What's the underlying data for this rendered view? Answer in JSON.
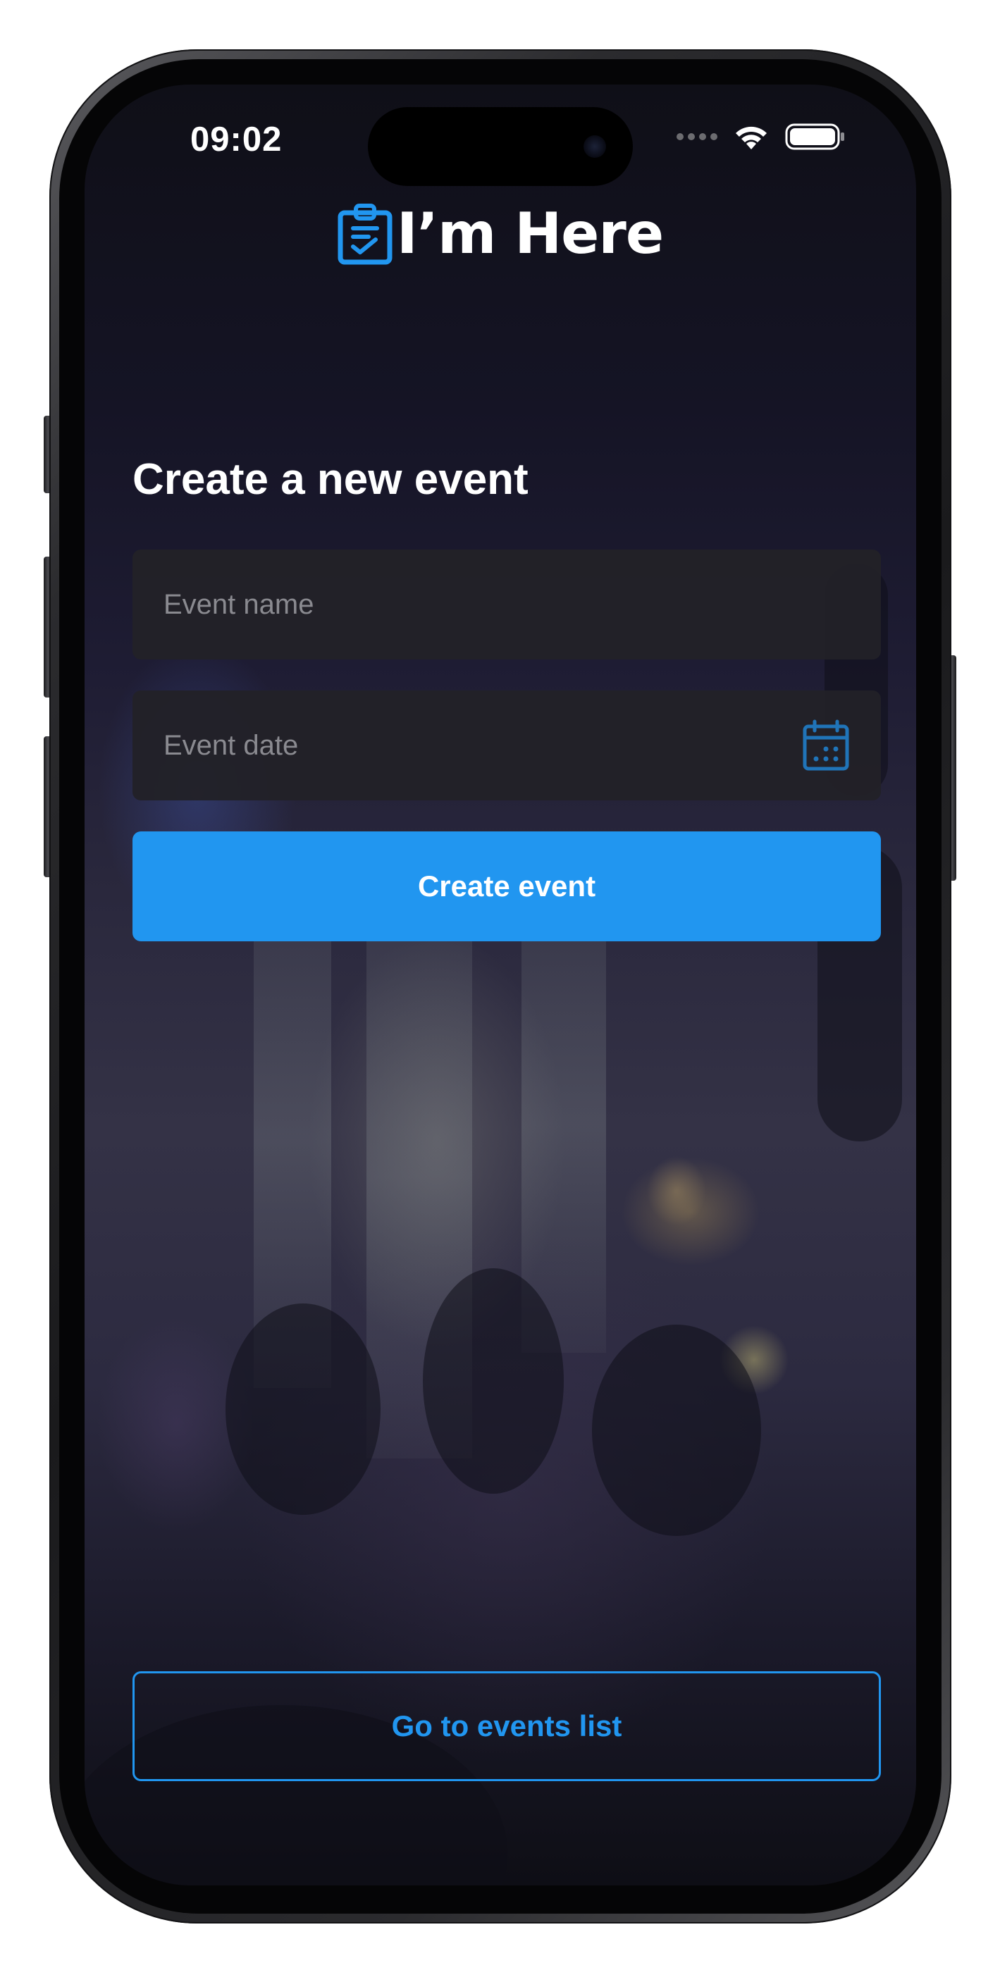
{
  "status_bar": {
    "time": "09:02",
    "signal_icon": "cellular-signal-icon",
    "wifi_icon": "wifi-icon",
    "battery_icon": "battery-icon"
  },
  "header": {
    "logo_icon": "clipboard-check-icon",
    "title": "I’m Here"
  },
  "form": {
    "heading": "Create a new event",
    "event_name": {
      "placeholder": "Event name",
      "value": ""
    },
    "event_date": {
      "placeholder": "Event date",
      "value": "",
      "icon": "calendar-icon"
    },
    "submit_label": "Create event"
  },
  "footer": {
    "events_list_label": "Go to events list"
  },
  "colors": {
    "accent": "#2196F0",
    "background": "#16151F",
    "field_background": "#222128",
    "text_primary": "#FFFFFF",
    "placeholder": "#8A8A90"
  }
}
